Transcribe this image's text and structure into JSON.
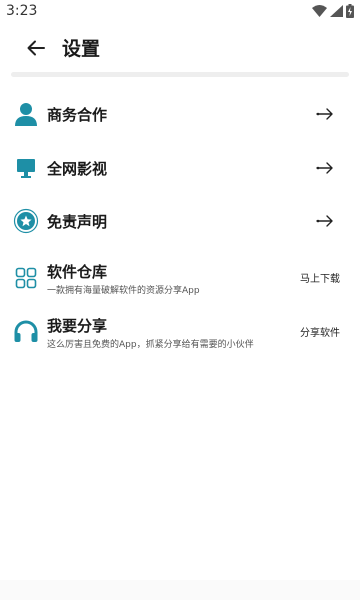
{
  "status_bar": {
    "time": "3:23"
  },
  "header": {
    "title": "设置"
  },
  "colors": {
    "accent": "#1e8fa6",
    "text": "#1a1a1a",
    "muted": "#555555",
    "divider": "#eeeeee"
  },
  "menu": [
    {
      "label": "商务合作",
      "icon": "person-icon"
    },
    {
      "label": "全网影视",
      "icon": "monitor-icon"
    },
    {
      "label": "免责声明",
      "icon": "star-badge-icon"
    }
  ],
  "features": [
    {
      "label": "软件仓库",
      "subtitle": "一款拥有海量破解软件的资源分享App",
      "action": "马上下载",
      "icon": "apps-grid-icon"
    },
    {
      "label": "我要分享",
      "subtitle": "这么厉害且免费的App，抓紧分享给有需要的小伙伴",
      "action": "分享软件",
      "icon": "headphones-icon"
    }
  ]
}
